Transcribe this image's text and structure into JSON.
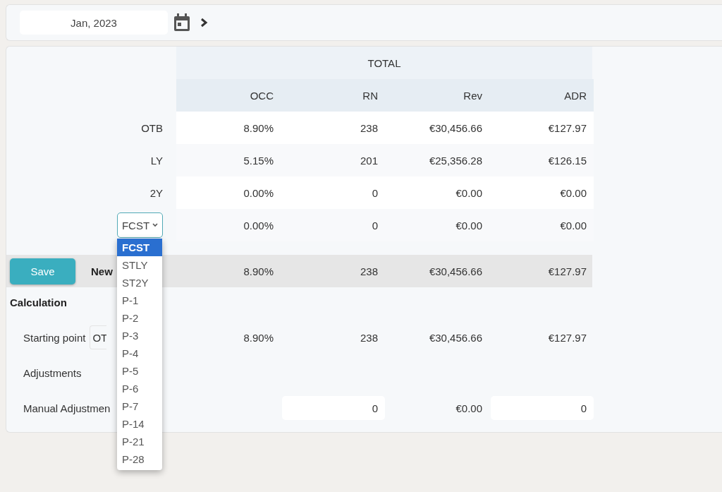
{
  "date_picker": {
    "value": "Jan, 2023"
  },
  "table": {
    "group_header": "TOTAL",
    "columns": [
      "OCC",
      "RN",
      "Rev",
      "ADR"
    ],
    "rows": [
      {
        "kind": "text",
        "label": "OTB",
        "values": [
          "8.90%",
          "238",
          "€30,456.66",
          "€127.97"
        ]
      },
      {
        "kind": "text",
        "label": "LY",
        "values": [
          "5.15%",
          "201",
          "€25,356.28",
          "€126.15"
        ]
      },
      {
        "kind": "text",
        "label": "2Y",
        "values": [
          "0.00%",
          "0",
          "€0.00",
          "€0.00"
        ]
      },
      {
        "kind": "select",
        "label": "FCST",
        "values": [
          "0.00%",
          "0",
          "€0.00",
          "€0.00"
        ]
      }
    ]
  },
  "dropdown": {
    "options": [
      {
        "label": "FCST",
        "selected": true
      },
      {
        "label": "STLY",
        "selected": false
      },
      {
        "label": "ST2Y",
        "selected": false
      },
      {
        "label": "P-1",
        "selected": false
      },
      {
        "label": "P-2",
        "selected": false
      },
      {
        "label": "P-3",
        "selected": false
      },
      {
        "label": "P-4",
        "selected": false
      },
      {
        "label": "P-5",
        "selected": false
      },
      {
        "label": "P-6",
        "selected": false
      },
      {
        "label": "P-7",
        "selected": false
      },
      {
        "label": "P-14",
        "selected": false
      },
      {
        "label": "P-21",
        "selected": false
      },
      {
        "label": "P-28",
        "selected": false
      }
    ]
  },
  "new_row": {
    "button": "Save",
    "label": "New",
    "values": [
      "8.90%",
      "238",
      "€30,456.66",
      "€127.97"
    ]
  },
  "calculation": {
    "title": "Calculation",
    "starting_point": {
      "label": "Starting point",
      "select_value": "OT",
      "values": [
        "8.90%",
        "238",
        "€30,456.66",
        "€127.97"
      ]
    },
    "adjustments": {
      "label": "Adjustments"
    },
    "manual": {
      "label": "Manual Adjustmen",
      "cells": [
        {
          "kind": "input",
          "value": "0"
        },
        {
          "kind": "text",
          "value": "€0.00"
        },
        {
          "kind": "input",
          "value": "0"
        }
      ]
    }
  }
}
